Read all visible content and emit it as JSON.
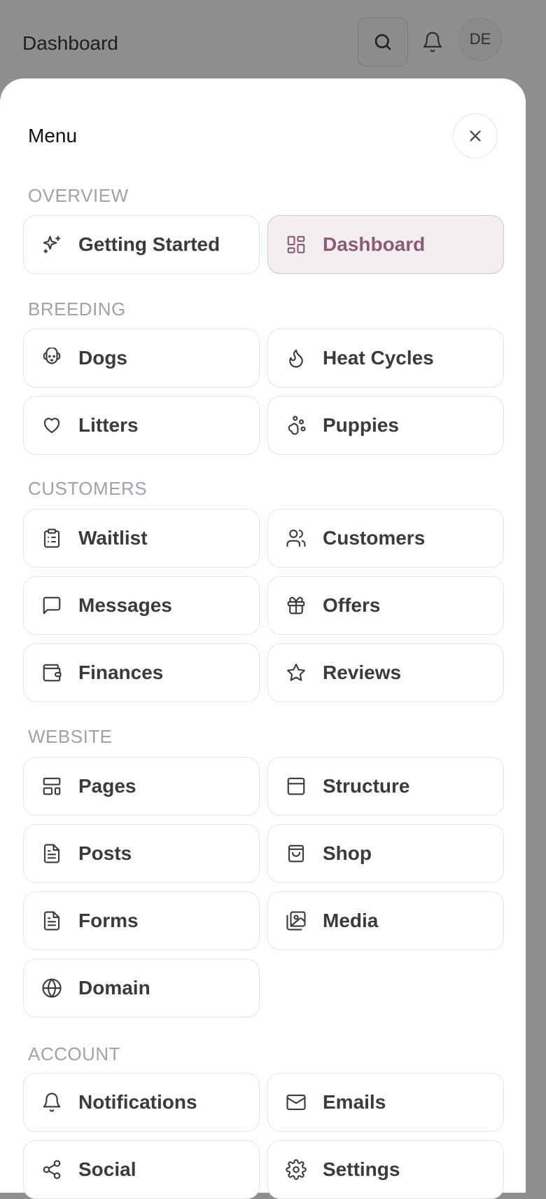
{
  "header": {
    "title": "Dashboard",
    "avatar_initials": "DE"
  },
  "menu": {
    "title": "Menu",
    "sections": [
      {
        "label": "OVERVIEW",
        "items": [
          {
            "label": "Getting Started",
            "icon": "sparkles-icon"
          },
          {
            "label": "Dashboard",
            "icon": "dashboard-grid-icon",
            "active": true
          }
        ]
      },
      {
        "label": "BREEDING",
        "items": [
          {
            "label": "Dogs",
            "icon": "dog-face-icon"
          },
          {
            "label": "Heat Cycles",
            "icon": "flame-icon"
          },
          {
            "label": "Litters",
            "icon": "heart-icon"
          },
          {
            "label": "Puppies",
            "icon": "paw-icon"
          }
        ]
      },
      {
        "label": "CUSTOMERS",
        "items": [
          {
            "label": "Waitlist",
            "icon": "clipboard-list-icon"
          },
          {
            "label": "Customers",
            "icon": "users-icon"
          },
          {
            "label": "Messages",
            "icon": "message-square-icon"
          },
          {
            "label": "Offers",
            "icon": "gift-icon"
          },
          {
            "label": "Finances",
            "icon": "wallet-icon"
          },
          {
            "label": "Reviews",
            "icon": "star-icon"
          }
        ]
      },
      {
        "label": "WEBSITE",
        "items": [
          {
            "label": "Pages",
            "icon": "layout-icon"
          },
          {
            "label": "Structure",
            "icon": "panel-top-icon"
          },
          {
            "label": "Posts",
            "icon": "file-text-icon"
          },
          {
            "label": "Shop",
            "icon": "shopping-bag-icon"
          },
          {
            "label": "Forms",
            "icon": "file-text-icon"
          },
          {
            "label": "Media",
            "icon": "images-icon"
          },
          {
            "label": "Domain",
            "icon": "globe-icon"
          }
        ]
      },
      {
        "label": "ACCOUNT",
        "items": [
          {
            "label": "Notifications",
            "icon": "bell-icon"
          },
          {
            "label": "Emails",
            "icon": "mail-icon"
          },
          {
            "label": "Social",
            "icon": "share-icon"
          },
          {
            "label": "Settings",
            "icon": "gear-icon"
          }
        ]
      }
    ]
  },
  "colors": {
    "active_bg": "#f5eef1",
    "active_text": "#8b5a76",
    "section_label": "#a1a1aa",
    "overlay": "#8f8f8f"
  }
}
